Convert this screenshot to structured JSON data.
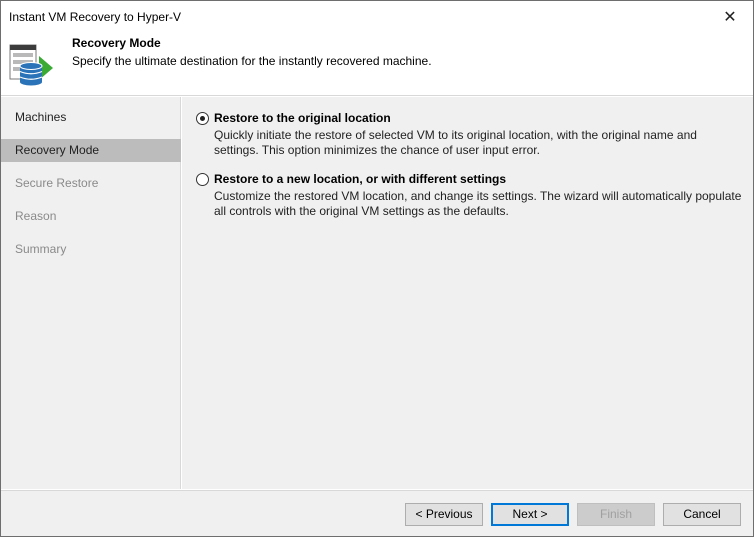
{
  "window": {
    "title": "Instant VM Recovery to Hyper-V",
    "close_glyph": "✕"
  },
  "header": {
    "icon": "vm-recovery-icon",
    "title": "Recovery Mode",
    "subtitle": "Specify the ultimate destination for the instantly recovered machine."
  },
  "sidebar": {
    "steps": [
      {
        "label": "Machines",
        "state": "done"
      },
      {
        "label": "Recovery Mode",
        "state": "active"
      },
      {
        "label": "Secure Restore",
        "state": "pending"
      },
      {
        "label": "Reason",
        "state": "pending"
      },
      {
        "label": "Summary",
        "state": "pending"
      }
    ]
  },
  "options": [
    {
      "label": "Restore to the original location",
      "description": "Quickly initiate the restore of selected VM to its original location, with the original name and settings. This option minimizes the chance of user input error.",
      "selected": true
    },
    {
      "label": "Restore to a new location, or with different settings",
      "description": "Customize the restored VM location, and change its settings. The wizard will automatically populate all controls with the original VM settings as the defaults.",
      "selected": false
    }
  ],
  "footer": {
    "previous": "< Previous",
    "next": "Next >",
    "finish": "Finish",
    "cancel": "Cancel"
  },
  "colors": {
    "active_step_bg": "#bcbcbc",
    "panel_bg": "#f0f0f0",
    "default_button_border": "#0078d7",
    "icon_green": "#3aaa35",
    "icon_blue": "#2a73b8"
  }
}
